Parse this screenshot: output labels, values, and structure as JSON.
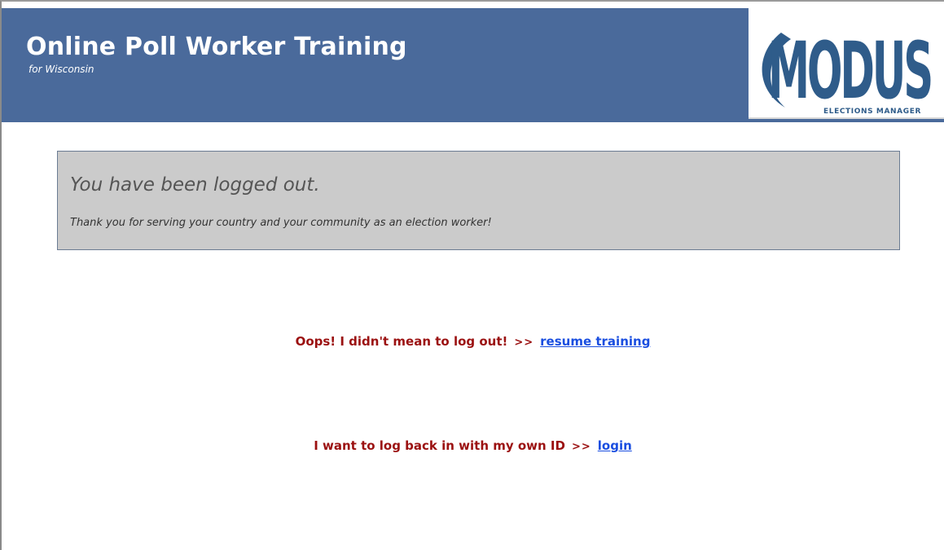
{
  "header": {
    "title": "Online Poll Worker Training",
    "subtitle": "for Wisconsin",
    "background_color": "#4a6a9b"
  },
  "logo": {
    "word": "MODUS",
    "tagline": "ELECTIONS MANAGER",
    "icon": "modus-logo",
    "color": "#2f5c8a"
  },
  "message": {
    "title": "You have been logged out.",
    "text": "Thank you for serving your country and your community as an election worker!"
  },
  "actions": [
    {
      "prompt": "Oops! I didn't mean to log out!",
      "arrow": ">>",
      "link_label": "resume training"
    },
    {
      "prompt": "I want to log back in with my own ID",
      "arrow": ">>",
      "link_label": "login"
    }
  ],
  "colors": {
    "prompt": "#9b1111",
    "link": "#1a4ee0",
    "message_box": "#cbcbcb"
  }
}
